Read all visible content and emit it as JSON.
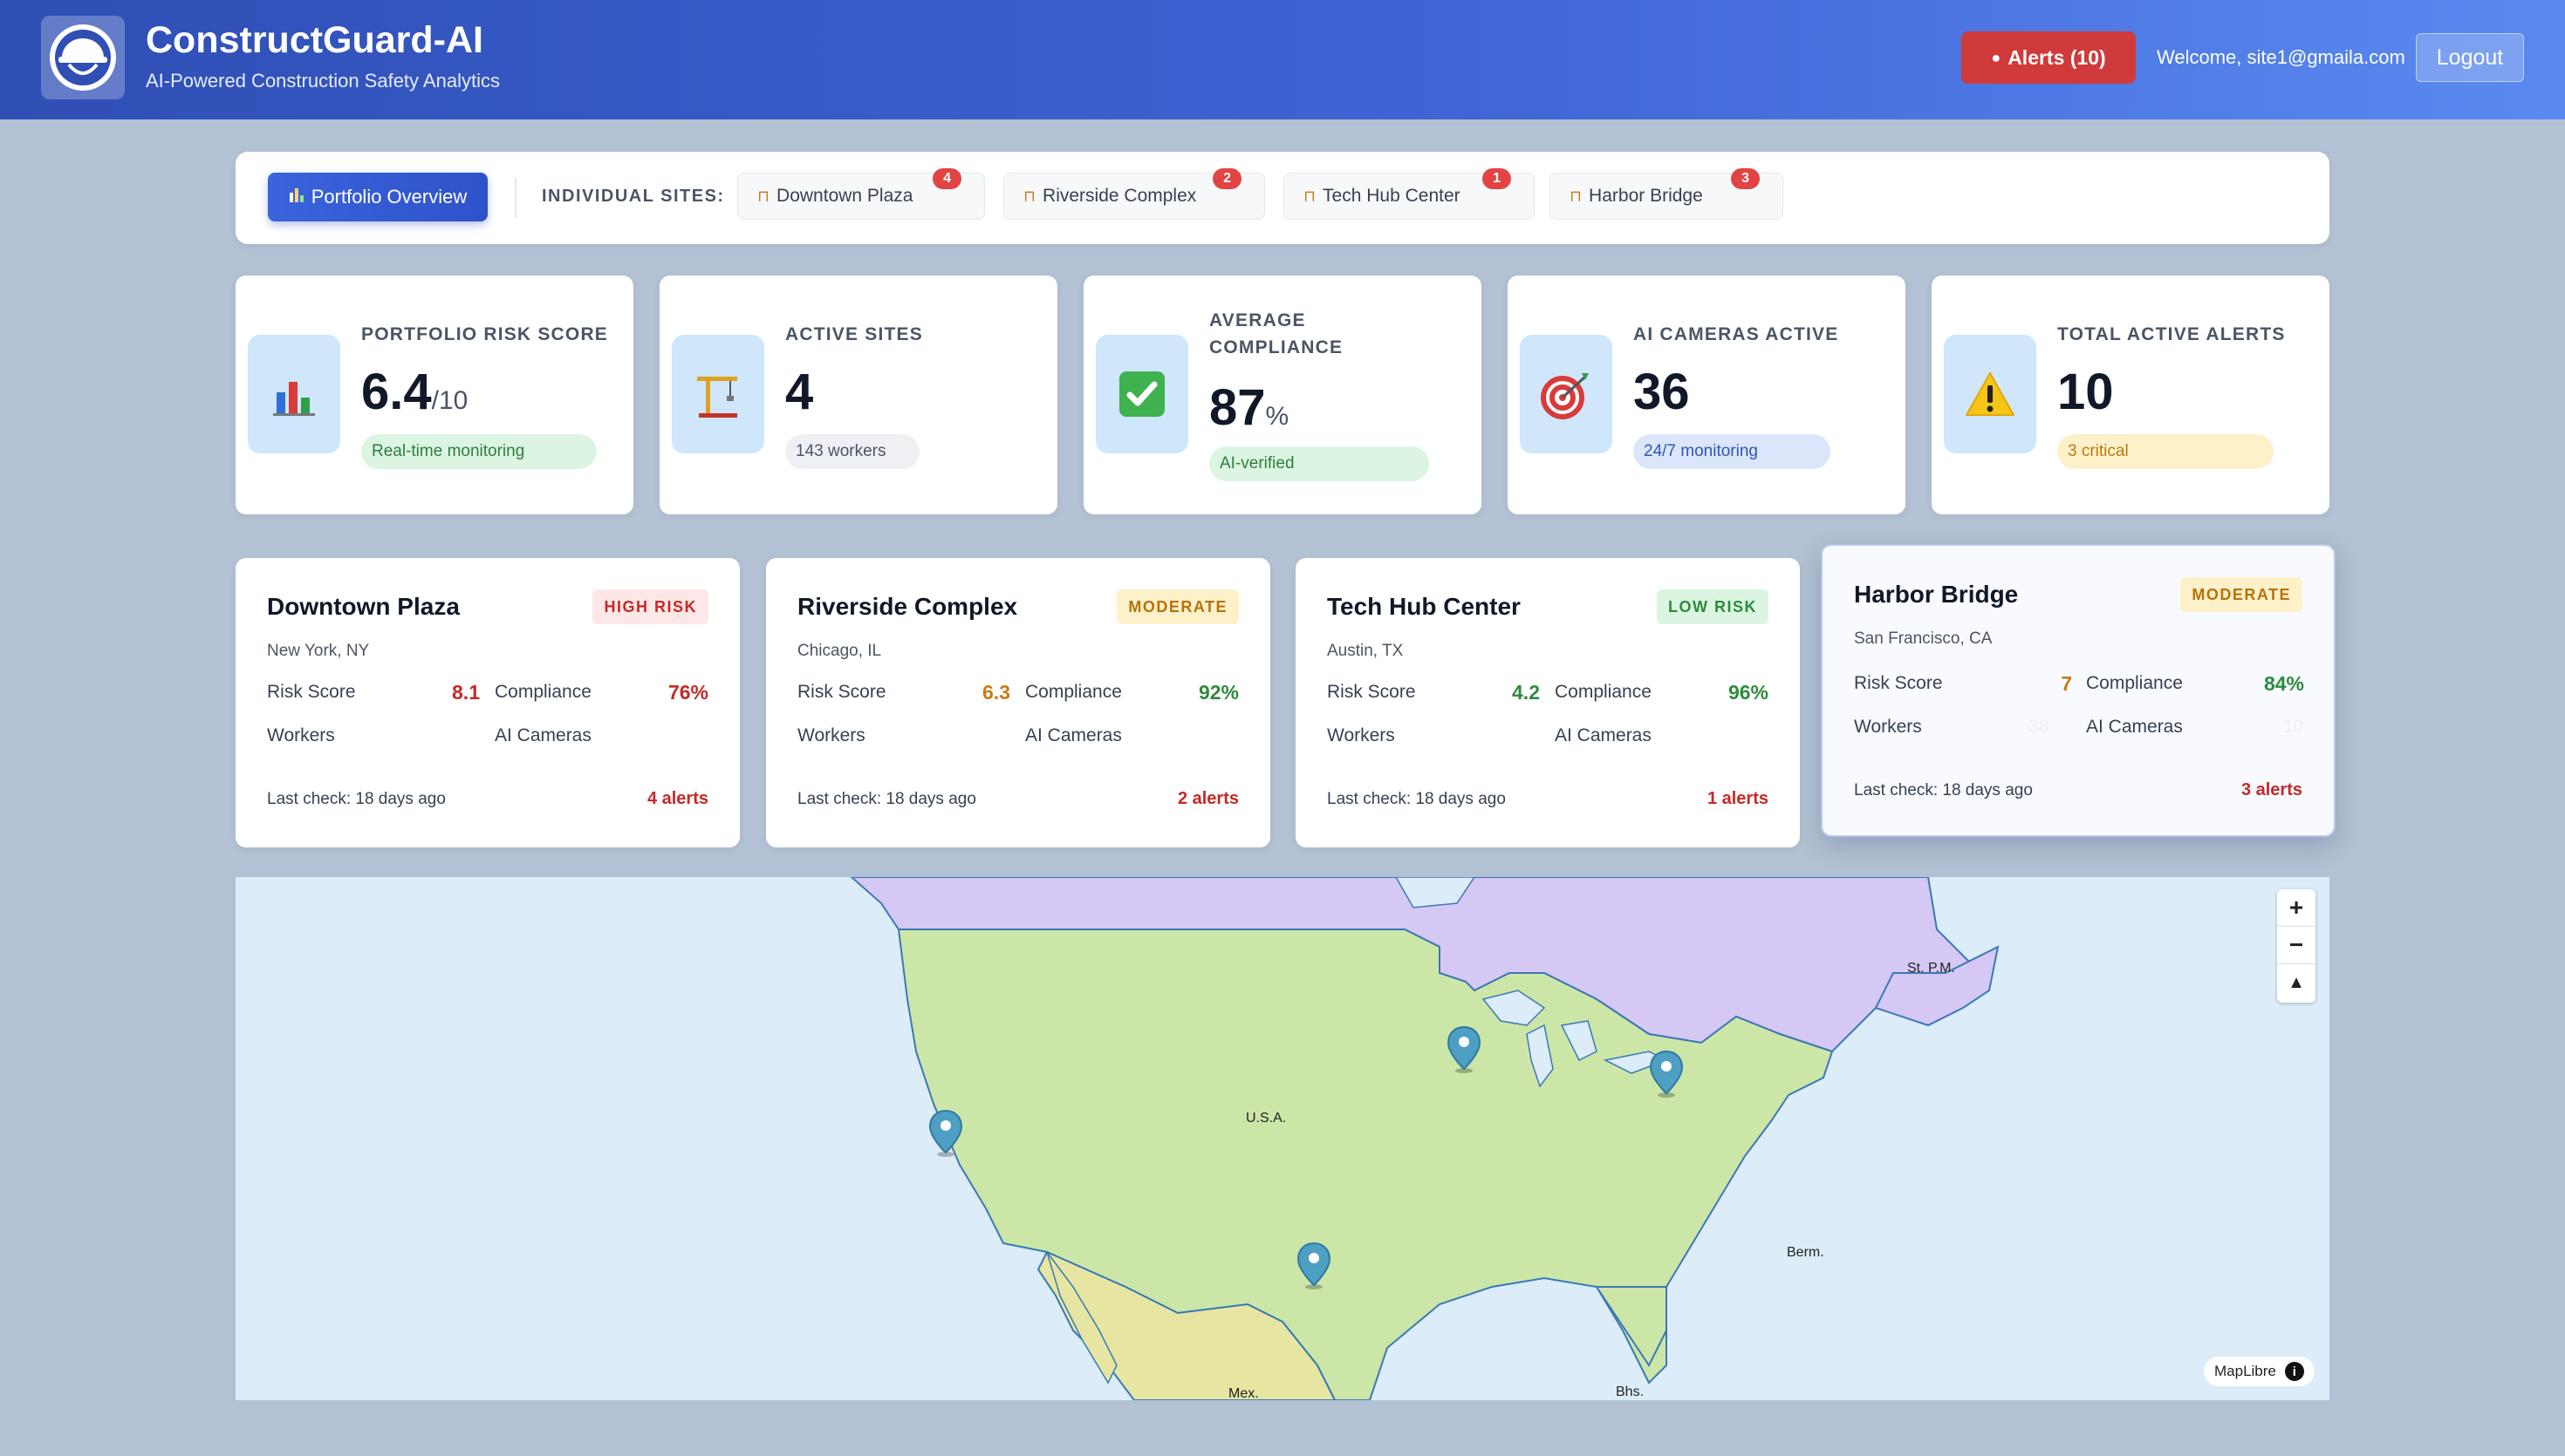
{
  "header": {
    "title": "ConstructGuard-AI",
    "subtitle": "AI-Powered Construction Safety Analytics",
    "alerts_button": "Alerts (10)",
    "welcome": "Welcome, site1@gmaila.com",
    "logout": "Logout"
  },
  "tabs": {
    "portfolio_label": "Portfolio Overview",
    "sites_label": "INDIVIDUAL SITES:",
    "sites": [
      {
        "label": "Downtown Plaza",
        "badge": "4"
      },
      {
        "label": "Riverside Complex",
        "badge": "2"
      },
      {
        "label": "Tech Hub Center",
        "badge": "1"
      },
      {
        "label": "Harbor Bridge",
        "badge": "3"
      }
    ]
  },
  "stats": [
    {
      "label": "PORTFOLIO RISK SCORE",
      "value": "6.4",
      "unit": "/10",
      "pill": "Real-time monitoring",
      "icon": "bar-chart-icon"
    },
    {
      "label": "ACTIVE SITES",
      "value": "4",
      "unit": "",
      "pill": "143 workers",
      "icon": "crane-icon"
    },
    {
      "label": "AVERAGE COMPLIANCE",
      "value": "87",
      "unit": "%",
      "pill": "AI-verified",
      "icon": "check-icon"
    },
    {
      "label": "AI CAMERAS ACTIVE",
      "value": "36",
      "unit": "",
      "pill": "24/7 monitoring",
      "icon": "target-icon"
    },
    {
      "label": "TOTAL ACTIVE ALERTS",
      "value": "10",
      "unit": "",
      "pill": "3 critical",
      "icon": "warning-icon"
    }
  ],
  "site_cards": [
    {
      "name": "Downtown Plaza",
      "badge": "HIGH RISK",
      "location": "New York, NY",
      "risk_label": "Risk Score",
      "risk": "8.1",
      "compliance_label": "Compliance",
      "compliance": "76%",
      "workers_label": "Workers",
      "workers": "",
      "cameras_label": "AI Cameras",
      "cameras": "",
      "last_check": "Last check: 18 days ago",
      "alerts": "4 alerts"
    },
    {
      "name": "Riverside Complex",
      "badge": "MODERATE",
      "location": "Chicago, IL",
      "risk_label": "Risk Score",
      "risk": "6.3",
      "compliance_label": "Compliance",
      "compliance": "92%",
      "workers_label": "Workers",
      "workers": "",
      "cameras_label": "AI Cameras",
      "cameras": "",
      "last_check": "Last check: 18 days ago",
      "alerts": "2 alerts"
    },
    {
      "name": "Tech Hub Center",
      "badge": "LOW RISK",
      "location": "Austin, TX",
      "risk_label": "Risk Score",
      "risk": "4.2",
      "compliance_label": "Compliance",
      "compliance": "96%",
      "workers_label": "Workers",
      "workers": "",
      "cameras_label": "AI Cameras",
      "cameras": "",
      "last_check": "Last check: 18 days ago",
      "alerts": "1 alerts"
    },
    {
      "name": "Harbor Bridge",
      "badge": "MODERATE",
      "location": "San Francisco, CA",
      "risk_label": "Risk Score",
      "risk": "7",
      "compliance_label": "Compliance",
      "compliance": "84%",
      "workers_label": "Workers",
      "workers": "38",
      "cameras_label": "AI Cameras",
      "cameras": "10",
      "last_check": "Last check: 18 days ago",
      "alerts": "3 alerts"
    }
  ],
  "map": {
    "labels": {
      "usa": "U.S.A.",
      "mexico": "Mex.",
      "bermuda": "Berm.",
      "stpm": "St. P.M.",
      "bahamas": "Bhs."
    },
    "controls": {
      "zoom_in": "+",
      "zoom_out": "−",
      "compass": "▲"
    },
    "attribution": "MapLibre",
    "info": "i"
  },
  "colors": {
    "header_start": "#2f4fb5",
    "header_end": "#5a8af0",
    "alert_red": "#d03a3a",
    "high_risk": "#c62828",
    "moderate": "#c77a14",
    "low_risk": "#2e8b3d",
    "page_bg": "#b2c1d3"
  }
}
